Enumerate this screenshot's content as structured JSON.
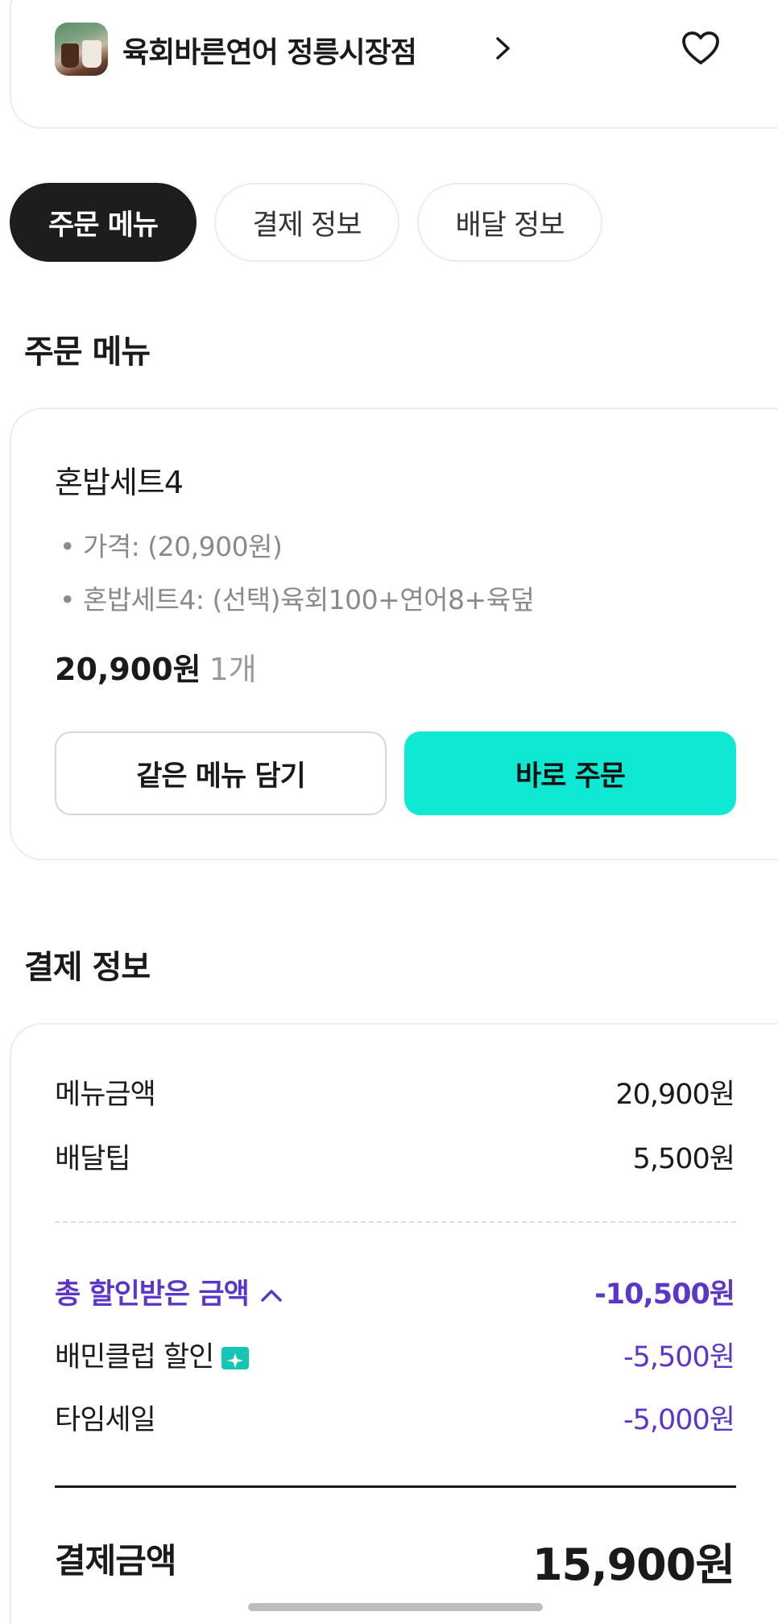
{
  "store": {
    "name": "육회바른연어 정릉시장점",
    "thumbnail_icon": "store-photo"
  },
  "tabs": [
    {
      "label": "주문 메뉴",
      "active": true
    },
    {
      "label": "결제 정보",
      "active": false
    },
    {
      "label": "배달 정보",
      "active": false
    }
  ],
  "order_menu": {
    "section_title": "주문 메뉴",
    "item": {
      "name": "혼밥세트4",
      "options": [
        "• 가격:  (20,900원)",
        "• 혼밥세트4: (선택)육회100+연어8+육덮"
      ],
      "price": "20,900원",
      "quantity": "1개"
    },
    "buttons": {
      "same_menu": "같은 메뉴 담기",
      "order_now": "바로 주문"
    }
  },
  "payment_info": {
    "section_title": "결제 정보",
    "rows": [
      {
        "label": "메뉴금액",
        "value": "20,900원"
      },
      {
        "label": "배달팁",
        "value": "5,500원"
      }
    ],
    "discount_total": {
      "label": "총 할인받은 금액",
      "value": "-10,500원"
    },
    "discounts": [
      {
        "label": "배민클럽 할인",
        "value": "-5,500원"
      },
      {
        "label": "타임세일",
        "value": "-5,000원"
      }
    ],
    "total": {
      "label": "결제금액",
      "value": "15,900원"
    }
  },
  "colors": {
    "accent": "#0fe8d2",
    "discount": "#5a36c9",
    "active_tab": "#1d1d1f"
  }
}
